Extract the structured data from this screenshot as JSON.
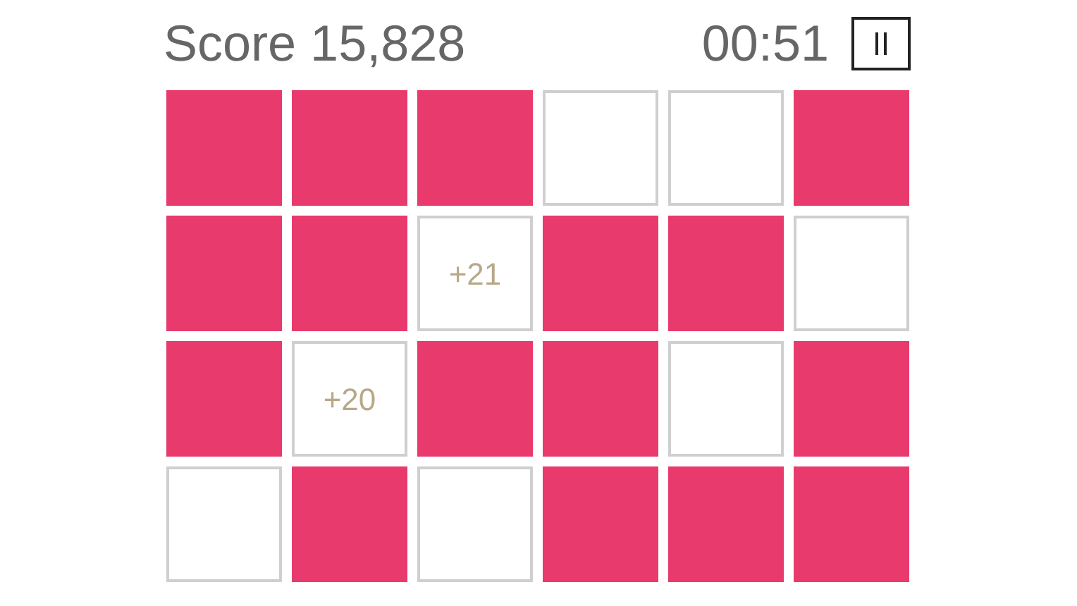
{
  "header": {
    "score": "Score 15,828",
    "timer": "00:51"
  },
  "rows": [
    [
      {
        "on": true
      },
      {
        "on": true
      },
      {
        "on": true
      },
      {
        "on": false
      },
      {
        "on": false
      },
      {
        "on": true
      }
    ],
    [
      {
        "on": true
      },
      {
        "on": true
      },
      {
        "on": false,
        "points": "+21"
      },
      {
        "on": true
      },
      {
        "on": true
      },
      {
        "on": false
      }
    ],
    [
      {
        "on": true
      },
      {
        "on": false,
        "points": "+20"
      },
      {
        "on": true
      },
      {
        "on": true
      },
      {
        "on": false
      },
      {
        "on": true
      }
    ],
    [
      {
        "on": false
      },
      {
        "on": true
      },
      {
        "on": false
      },
      {
        "on": true
      },
      {
        "on": true
      },
      {
        "on": true
      }
    ]
  ]
}
